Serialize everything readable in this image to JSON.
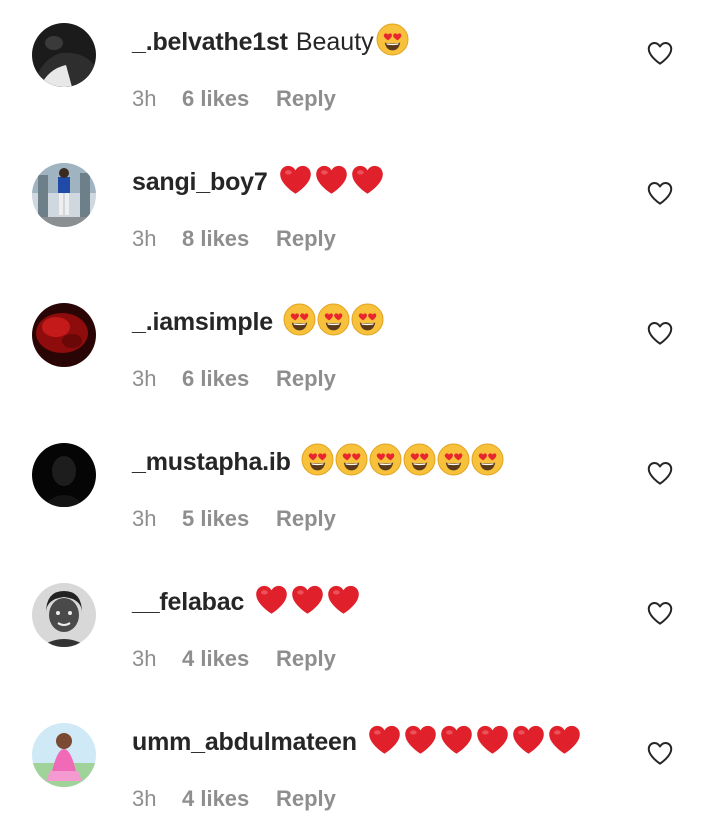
{
  "comments": [
    {
      "username": "_.belvathe1st",
      "text": "Beauty",
      "emojis": [
        "heart-eyes"
      ],
      "time": "3h",
      "likes": "6 likes",
      "reply": "Reply",
      "avatar": "dark"
    },
    {
      "username": "sangi_boy7",
      "text": "",
      "emojis": [
        "red-heart",
        "red-heart",
        "red-heart"
      ],
      "time": "3h",
      "likes": "8 likes",
      "reply": "Reply",
      "avatar": "photo-blue"
    },
    {
      "username": "_.iamsimple",
      "text": "",
      "emojis": [
        "heart-eyes",
        "heart-eyes",
        "heart-eyes"
      ],
      "time": "3h",
      "likes": "6 likes",
      "reply": "Reply",
      "avatar": "red"
    },
    {
      "username": "_mustapha.ib",
      "text": "",
      "emojis": [
        "heart-eyes",
        "heart-eyes",
        "heart-eyes",
        "heart-eyes",
        "heart-eyes",
        "heart-eyes"
      ],
      "time": "3h",
      "likes": "5 likes",
      "reply": "Reply",
      "avatar": "black"
    },
    {
      "username": "__felabac",
      "text": "",
      "emojis": [
        "red-heart",
        "red-heart",
        "red-heart"
      ],
      "time": "3h",
      "likes": "4 likes",
      "reply": "Reply",
      "avatar": "gray"
    },
    {
      "username": "umm_abdulmateen",
      "text": "",
      "emojis": [
        "red-heart",
        "red-heart",
        "red-heart",
        "red-heart",
        "red-heart",
        "red-heart"
      ],
      "time": "3h",
      "likes": "4 likes",
      "reply": "Reply",
      "avatar": "pink"
    }
  ],
  "colors": {
    "username": "#262626",
    "meta": "#8e8e8e",
    "heart": "#e0202a",
    "emoji_face": "#f7c13b",
    "emoji_eye": "#e8262f"
  }
}
